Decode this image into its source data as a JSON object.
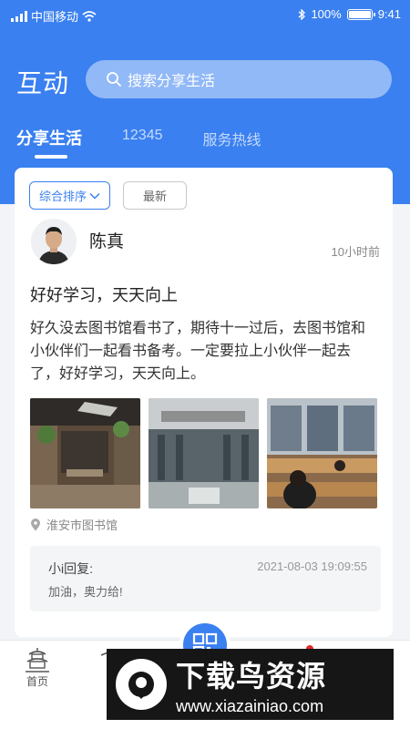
{
  "status_bar": {
    "carrier": "中国移动",
    "battery": "100%",
    "time": "9:41"
  },
  "header": {
    "title": "互动",
    "search_placeholder": "搜索分享生活",
    "tabs": [
      {
        "label": "分享生活",
        "active": true
      },
      {
        "label": "12345",
        "active": false
      },
      {
        "label": "服务热线",
        "active": false
      }
    ]
  },
  "sort": {
    "options": [
      {
        "label": "综合排序",
        "active": true
      },
      {
        "label": "最新",
        "active": false
      }
    ]
  },
  "post": {
    "author": "陈真",
    "time": "10小时前",
    "title": "好好学习，天天向上",
    "body": "好久没去图书馆看书了，期待十一过后，去图书馆和小伙伴们一起看书备考。一定要拉上小伙伴一起去了，好好学习，天天向上。",
    "location": "淮安市图书馆",
    "reply": {
      "name": "小i回复:",
      "time": "2021-08-03  19:09:55",
      "text": "加油，奥力给!"
    }
  },
  "tabbar": {
    "home_label": "首页"
  },
  "watermark": {
    "title": "下载鸟资源",
    "url": "www.xiazainiao.com"
  },
  "colors": {
    "accent": "#3a80f0",
    "notification": "#e02b2b"
  }
}
